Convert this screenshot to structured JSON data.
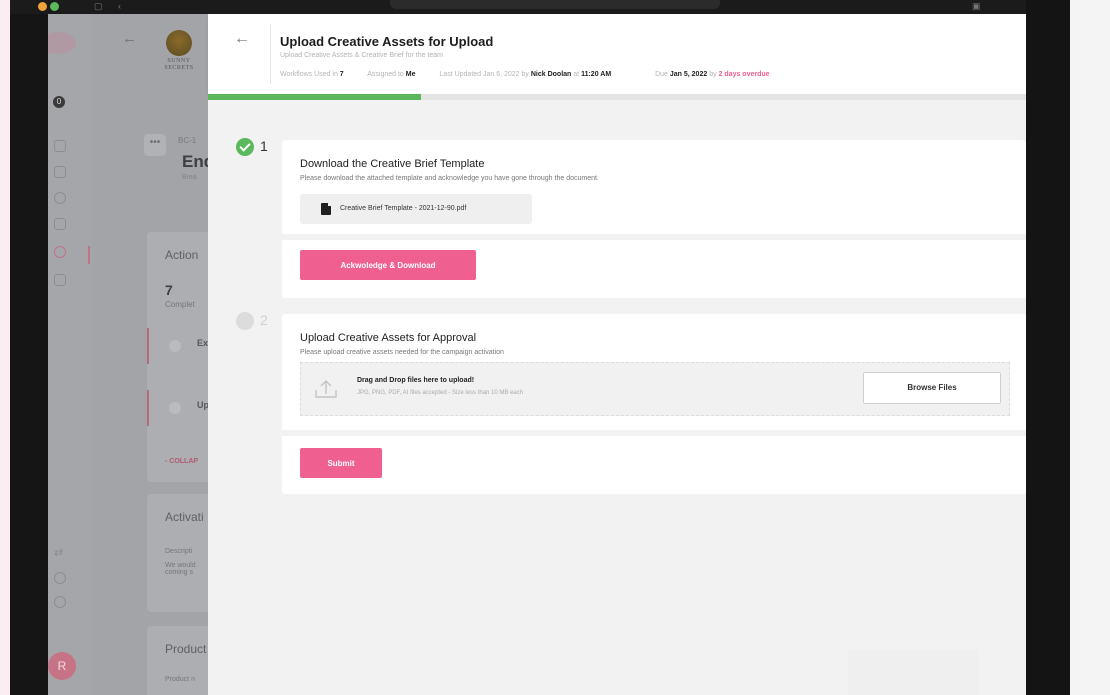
{
  "background_app": {
    "notification_count": "0",
    "brand_name": "SUNNY SECRETS",
    "overflow_icon": "more-horizontal-icon",
    "record_code": "BC-1",
    "record_title": "End",
    "record_subtitle": "Brea",
    "action_card": {
      "heading": "Action",
      "count": "7",
      "count_label": "Complet",
      "item_1_letter": "Ex",
      "item_2_letter": "Up",
      "collapse_label": "- COLLAP"
    },
    "activation_card": {
      "heading": "Activati",
      "desc_label": "Descripti",
      "desc_text": "We would coming s"
    },
    "product_card": {
      "heading": "Product",
      "sub": "Product n"
    },
    "avatar_initial": "R"
  },
  "panel": {
    "title": "Upload Creative Assets for Upload",
    "subtitle": "Upload Creative Assets & Creative Brief for the team",
    "meta": {
      "workflows_label": "Workflows Used in",
      "workflows_value": "7",
      "assigned_label": "Assigned to",
      "assigned_value": "Me",
      "updated_label": "Last Updated Jan 6, 2022 by",
      "updated_by": "Nick Doolan",
      "updated_at_label": "at",
      "updated_time": "11:20 AM",
      "due_label": "Due",
      "due_date": "Jan 5, 2022",
      "due_by_label": "by",
      "overdue_text": "2 days overdue"
    },
    "progress_percent": 26,
    "colors": {
      "accent": "#ef5f8f",
      "success": "#5cb85c"
    }
  },
  "steps": [
    {
      "number": "1",
      "status": "done",
      "title": "Download the Creative Brief Template",
      "description": "Please download the attached template and acknowledge you have gone through the document.",
      "file_name": "Creative Brief Template - 2021-12-90.pdf",
      "file_icon": "pdf-icon",
      "button_label": "Ackwoledge & Download"
    },
    {
      "number": "2",
      "status": "pending",
      "title": "Upload Creative Assets for Approval",
      "description": "Please upload creative assets needed for the campaign activation",
      "dropzone_title": "Drag and Drop files here to upload!",
      "dropzone_hint": "JPG, PNG, PDF, AI files accepted - Size less than 10 MB each",
      "dropzone_icon": "upload-icon",
      "browse_label": "Browse Files",
      "submit_label": "Submit"
    }
  ]
}
